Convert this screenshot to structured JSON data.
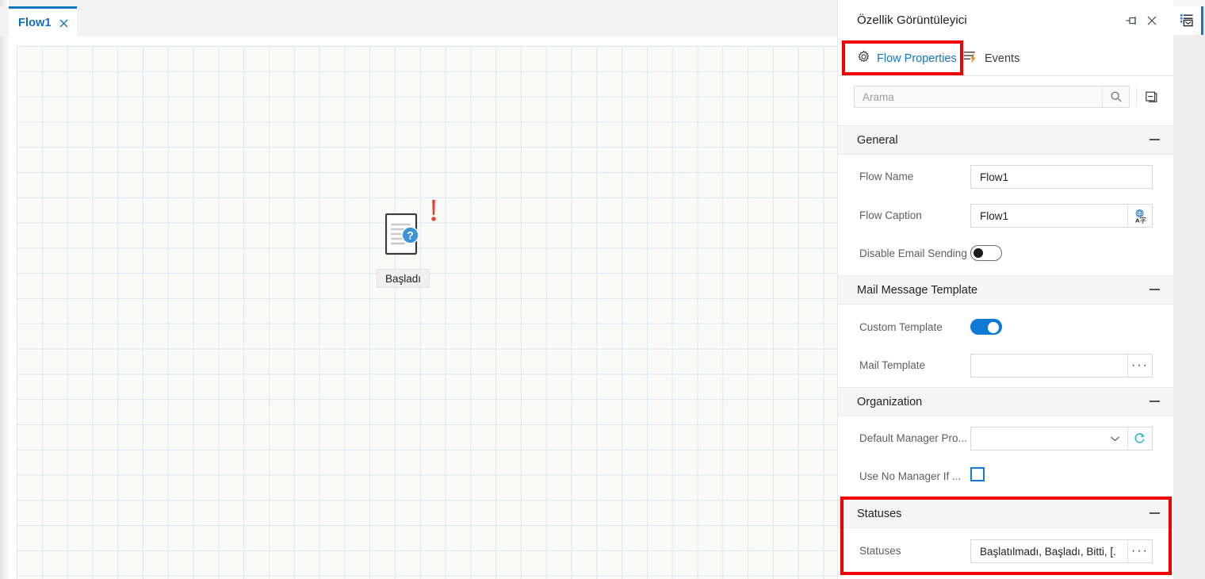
{
  "editor": {
    "tab": {
      "label": "Flow1",
      "close_icon": "close-icon"
    },
    "canvas": {
      "node": {
        "caption": "Başladı",
        "doc_icon": "document-question-icon",
        "warning_icon": "exclamation-icon"
      },
      "grid_color": "#dce6f2",
      "background": "#fafaf9"
    }
  },
  "panel": {
    "title": "Özellik Görüntüleyici",
    "pin_icon": "pin-icon",
    "close_icon": "close-icon",
    "tabs": [
      {
        "label": "Flow Properties",
        "icon": "gear-icon",
        "active": true
      },
      {
        "label": "Events",
        "icon": "events-lightning-icon",
        "active": false
      }
    ],
    "search": {
      "placeholder": "Arama",
      "value": "",
      "search_icon": "search-icon",
      "collapse_all_icon": "collapse-panels-icon"
    },
    "groups": [
      {
        "title": "General",
        "collapse_icon": "minus-icon",
        "rows": [
          {
            "label": "Flow Name",
            "type": "text",
            "value": "Flow1"
          },
          {
            "label": "Flow Caption",
            "type": "text-with-button",
            "value": "Flow1",
            "button_icon": "translate-icon"
          },
          {
            "label": "Disable Email Sending",
            "type": "toggle",
            "value": "off"
          }
        ]
      },
      {
        "title": "Mail Message Template",
        "collapse_icon": "minus-icon",
        "rows": [
          {
            "label": "Custom Template",
            "type": "toggle",
            "value": "on"
          },
          {
            "label": "Mail Template",
            "type": "text-with-button",
            "value": "",
            "button_icon": "ellipsis-icon",
            "button_label": "···"
          }
        ]
      },
      {
        "title": "Organization",
        "collapse_icon": "minus-icon",
        "rows": [
          {
            "label": "Default Manager Pro...",
            "type": "dropdown-with-refresh",
            "value": "",
            "dropdown_icon": "chevron-down-icon",
            "button_icon": "refresh-icon"
          },
          {
            "label": "Use No Manager If ...",
            "type": "checkbox",
            "value": "unchecked"
          }
        ]
      },
      {
        "title": "Statuses",
        "collapse_icon": "minus-icon",
        "highlighted": true,
        "rows": [
          {
            "label": "Statuses",
            "type": "text-with-button",
            "value": "Başlatılmadı, Başladı, Bitti, [.",
            "button_icon": "ellipsis-icon",
            "button_label": "···"
          }
        ]
      }
    ]
  },
  "edge_rail": {
    "buttons": [
      {
        "icon": "property-viewer-icon",
        "active": true
      }
    ]
  },
  "colors": {
    "accent_blue": "#0f7ad6",
    "tab_blue": "#1277c4",
    "highlight_red": "#f20000",
    "refresh_teal": "#12b0c4",
    "warning_red": "#e8402a",
    "group_header_bg": "#f5f5f5"
  }
}
